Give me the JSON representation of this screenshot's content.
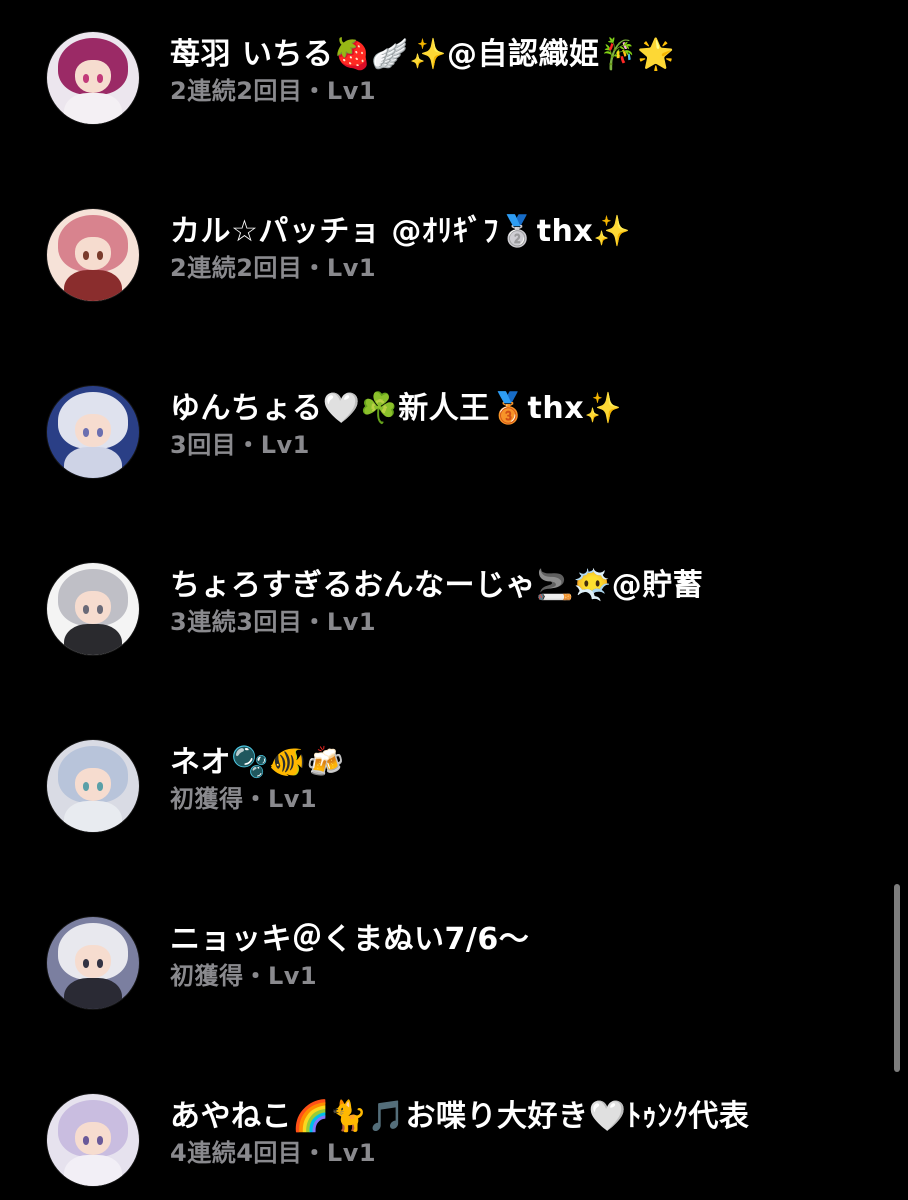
{
  "rows": [
    {
      "name": "苺羽 いちる🍓🪽✨@自認織姫🎋🌟",
      "meta": "2連続2回目・Lv1",
      "avatar": {
        "bg": "#ece6ee",
        "hair": "#9b2a66",
        "eye": "#c23a7a",
        "body": "#f4f0f4"
      }
    },
    {
      "name": "カル☆パッチョ @ｵﾘｷﾞﾌ🥈thx✨",
      "meta": "2連続2回目・Lv1",
      "avatar": {
        "bg": "#f6e2d8",
        "hair": "#d8838e",
        "eye": "#7a3b2c",
        "body": "#8a2d2d"
      }
    },
    {
      "name": "ゆんちょる🤍☘️新人王🥉thx✨",
      "meta": "3回目・Lv1",
      "avatar": {
        "bg": "#2a3f86",
        "hair": "#dfe2ee",
        "eye": "#6b6fb0",
        "body": "#ced3e6"
      }
    },
    {
      "name": "ちょろすぎるおんなーじゃ🚬😶‍🌫️@貯蓄",
      "meta": "3連続3回目・Lv1",
      "avatar": {
        "bg": "#f4f4f4",
        "hair": "#bfbfc6",
        "eye": "#6a6a78",
        "body": "#2a2a2e"
      }
    },
    {
      "name": "ネオ🫧🐠🍻",
      "meta": "初獲得・Lv1",
      "avatar": {
        "bg": "#d9dbe4",
        "hair": "#b8c4da",
        "eye": "#5aa0a8",
        "body": "#e8ebf0"
      }
    },
    {
      "name": "ニョッキ＠くまぬい7/6～",
      "meta": "初獲得・Lv1",
      "avatar": {
        "bg": "#7b7fa0",
        "hair": "#e8e8ee",
        "eye": "#333344",
        "body": "#2a2a34"
      }
    },
    {
      "name": "あやねこ🌈🐈🎵お喋り大好き🤍ﾄｩﾝｸ代表",
      "meta": "4連続4回目・Lv1",
      "avatar": {
        "bg": "#e6e2ee",
        "hair": "#c9bde0",
        "eye": "#6a5a9a",
        "body": "#f2eff6"
      }
    }
  ]
}
